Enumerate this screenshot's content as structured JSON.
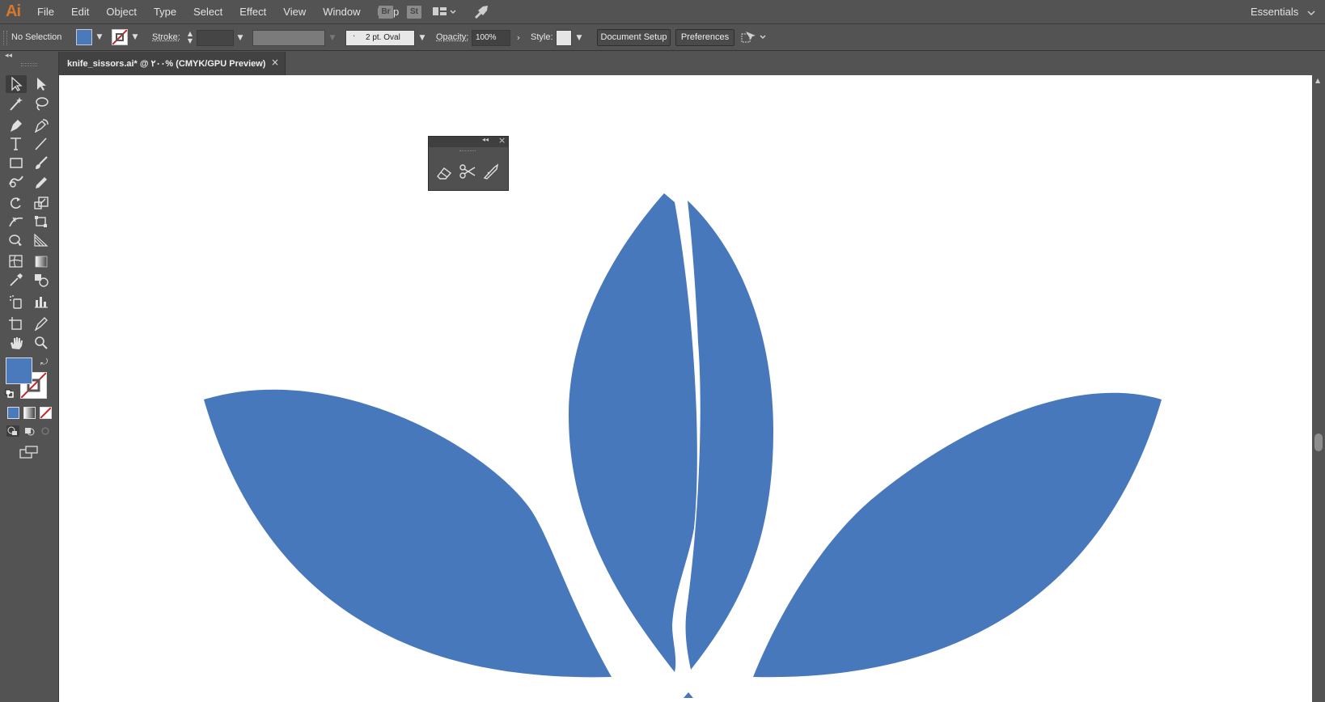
{
  "app": {
    "logo": "Ai",
    "menus": [
      "File",
      "Edit",
      "Object",
      "Type",
      "Select",
      "Effect",
      "View",
      "Window",
      "Help"
    ],
    "bridge_label": "Br",
    "stock_label": "St",
    "workspace": "Essentials"
  },
  "control": {
    "selection_status": "No Selection",
    "stroke_label": "Stroke:",
    "brush_label": "2 pt. Oval",
    "opacity_label": "Opacity:",
    "opacity_value": "100%",
    "style_label": "Style:",
    "document_setup": "Document Setup",
    "preferences": "Preferences"
  },
  "document": {
    "tab_title": "knife_sissors.ai* @ ۲۰۰% (CMYK/GPU Preview)",
    "close_glyph": "×"
  },
  "colors": {
    "fill": "#4a7abb",
    "artwork": "#4878bc",
    "accent_logo": "#d9772c",
    "stroke_none": "#cc2222"
  },
  "tools": [
    "selection-tool-icon",
    "direct-selection-tool-icon",
    "magic-wand-tool-icon",
    "lasso-tool-icon",
    "pen-tool-icon",
    "curvature-tool-icon",
    "type-tool-icon",
    "line-segment-tool-icon",
    "rectangle-tool-icon",
    "paintbrush-tool-icon",
    "shaper-tool-icon",
    "pencil-tool-icon",
    "rotate-tool-icon",
    "scale-tool-icon",
    "width-tool-icon",
    "free-transform-tool-icon",
    "shape-builder-tool-icon",
    "perspective-grid-tool-icon",
    "mesh-tool-icon",
    "gradient-tool-icon",
    "eyedropper-tool-icon",
    "blend-tool-icon",
    "symbol-sprayer-tool-icon",
    "column-graph-tool-icon",
    "artboard-tool-icon",
    "slice-tool-icon",
    "hand-tool-icon",
    "zoom-tool-icon"
  ],
  "floating_panel": {
    "tools": [
      "eraser-tool-icon",
      "scissors-tool-icon",
      "knife-tool-icon"
    ]
  }
}
